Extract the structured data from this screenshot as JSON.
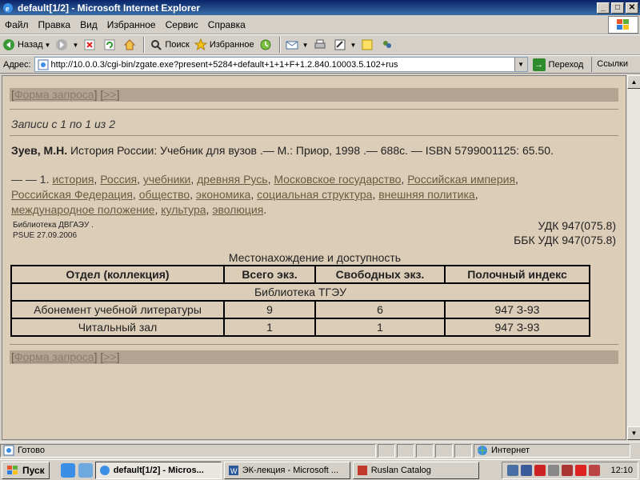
{
  "window": {
    "title": "default[1/2] - Microsoft Internet Explorer",
    "min_label": "_",
    "max_label": "□",
    "close_label": "✕"
  },
  "menu": [
    "Файл",
    "Правка",
    "Вид",
    "Избранное",
    "Сервис",
    "Справка"
  ],
  "toolbar": {
    "back_label": "Назад",
    "search_label": "Поиск",
    "favorites_label": "Избранное"
  },
  "address": {
    "label": "Адрес:",
    "url": "http://10.0.0.3/cgi-bin/zgate.exe?present+5284+default+1+1+F+1.2.840.10003.5.102+rus",
    "go_label": "Переход",
    "links_label": "Ссылки"
  },
  "page": {
    "nav_open": "[",
    "query_form_link": "Форма запроса",
    "nav_mid": "] [",
    "next_link": ">>",
    "nav_close": "]",
    "records_text": "Записи с 1 по 1 из 2",
    "author": "Зуев, М.Н.",
    "biblio_rest": " История России: Учебник для вузов .— М.: Приор, 1998 .— 688с. — ISBN 5799001125: 65.50.",
    "subjects_prefix": "— — 1. ",
    "subjects": [
      "история",
      "Россия",
      "учебники",
      "древняя Русь",
      "Московское государство",
      "Российская империя",
      "Российская Федерация",
      "общество",
      "экономика",
      "социальная структура",
      "внешняя политика",
      "международное положение",
      "культура",
      "эволюция"
    ],
    "lib_line1": "Библиотека ДВГАЭУ .",
    "lib_line2": "PSUE 27.09.2006",
    "udk_line": "УДК 947(075.8)",
    "bbk_line": "ББК УДК 947(075.8)",
    "availability_title": "Местонахождение и доступность",
    "table_headers": [
      "Отдел (коллекция)",
      "Всего экз.",
      "Свободных экз.",
      "Полочный индекс"
    ],
    "library_name": "Библиотека ТГЭУ",
    "rows": [
      {
        "dept": "Абонемент учебной литературы",
        "total": "9",
        "free": "6",
        "shelf": "947 З-93"
      },
      {
        "dept": "Читальный зал",
        "total": "1",
        "free": "1",
        "shelf": "947 З-93"
      }
    ]
  },
  "status": {
    "text": "Готово",
    "zone": "Интернет"
  },
  "taskbar": {
    "start_label": "Пуск",
    "tasks": [
      "default[1/2] - Micros...",
      "ЭК-лекция - Microsoft ...",
      "Ruslan Catalog"
    ],
    "clock": "12:10"
  },
  "colors": {
    "content_bg": "#dccdb8",
    "nav_bar": "#b2a491",
    "title_bar": "#0a246a"
  }
}
